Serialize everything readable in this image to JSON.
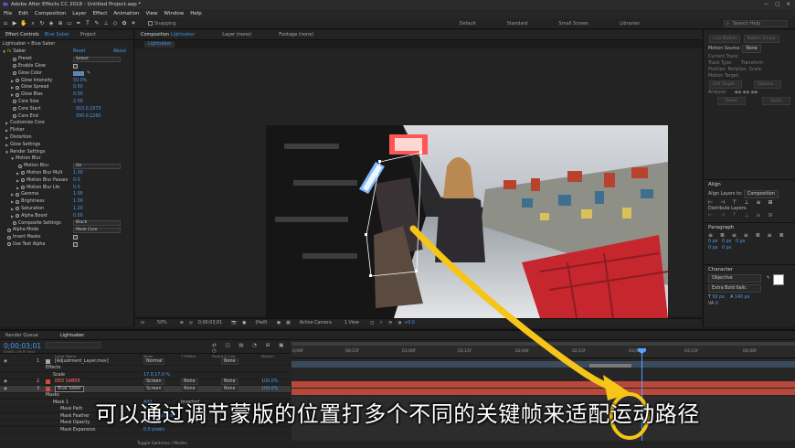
{
  "window": {
    "title": "Adobe After Effects CC 2018 - Untitled Project.aep *",
    "controls": [
      "—",
      "□",
      "✕"
    ]
  },
  "menu": [
    "File",
    "Edit",
    "Composition",
    "Layer",
    "Effect",
    "Animation",
    "View",
    "Window",
    "Help"
  ],
  "toolbar": {
    "snapping_label": "Snapping",
    "workspaces": [
      "Default",
      "Standard",
      "Small Screen",
      "Libraries"
    ],
    "search_placeholder": "Search Help"
  },
  "effect_panel": {
    "tabs": [
      "Effect Controls",
      "Blue Saber",
      "Project"
    ],
    "layer_path": "Lightsaber • Blue Saber",
    "effect_name": "Saber",
    "reset_label": "Reset",
    "about_label": "About",
    "rows": [
      {
        "label": "Preset",
        "value": "Select",
        "type": "select",
        "indent": 1
      },
      {
        "label": "Enable Glow",
        "value": "",
        "type": "check",
        "indent": 1
      },
      {
        "label": "Glow Color",
        "value": "",
        "type": "color",
        "indent": 1
      },
      {
        "label": "Glow Intensity",
        "value": "50.0%",
        "type": "num",
        "indent": 1
      },
      {
        "label": "Glow Spread",
        "value": "0.50",
        "type": "num",
        "indent": 1
      },
      {
        "label": "Glow Bias",
        "value": "0.50",
        "type": "num",
        "indent": 1
      },
      {
        "label": "Core Size",
        "value": "2.00",
        "type": "num",
        "indent": 1
      },
      {
        "label": "Core Start",
        "value": "910.0,1973",
        "type": "num",
        "indent": 1
      },
      {
        "label": "Core End",
        "value": "590.0,1260",
        "type": "num",
        "indent": 1
      },
      {
        "label": "Customize Core",
        "value": "",
        "type": "group",
        "indent": 0
      },
      {
        "label": "Flicker",
        "value": "",
        "type": "group",
        "indent": 0
      },
      {
        "label": "Distortion",
        "value": "",
        "type": "group",
        "indent": 0
      },
      {
        "label": "Glow Settings",
        "value": "",
        "type": "group",
        "indent": 0
      },
      {
        "label": "Render Settings",
        "value": "",
        "type": "group",
        "indent": 0
      },
      {
        "label": "Motion Blur",
        "value": "",
        "type": "group",
        "indent": 1
      },
      {
        "label": "Motion Blur",
        "value": "On",
        "type": "select",
        "indent": 2
      },
      {
        "label": "Motion Blur Mult",
        "value": "1.00",
        "type": "num",
        "indent": 2
      },
      {
        "label": "Motion Blur Passes",
        "value": "0.0",
        "type": "num",
        "indent": 2
      },
      {
        "label": "Motion Blur Lfe",
        "value": "0.0",
        "type": "num",
        "indent": 2
      },
      {
        "label": "Gamma",
        "value": "1.00",
        "type": "num",
        "indent": 1
      },
      {
        "label": "Brightness",
        "value": "1.00",
        "type": "num",
        "indent": 1
      },
      {
        "label": "Saturation",
        "value": "1.20",
        "type": "num",
        "indent": 1
      },
      {
        "label": "Alpha Boost",
        "value": "0.00",
        "type": "num",
        "indent": 1
      },
      {
        "label": "Composite Settings",
        "value": "Black",
        "type": "select",
        "indent": 1
      },
      {
        "label": "Alpha Mode",
        "value": "Mask Core",
        "type": "select",
        "indent": 0
      },
      {
        "label": "Invert Masks",
        "value": "",
        "type": "check",
        "indent": 0
      },
      {
        "label": "Use Text Alpha",
        "value": "",
        "type": "check",
        "indent": 0
      }
    ]
  },
  "comp": {
    "tabs": [
      "Composition",
      "Lightsaber",
      "Layer (none)",
      "Footage (none)"
    ],
    "subtab": "Lightsaber",
    "footer": [
      "50%",
      "0;00;03;01",
      "(Half)",
      "Active Camera",
      "1 View",
      "+0.0"
    ]
  },
  "right_panel": {
    "top_buttons": [
      "Line Motion",
      "Motion Smear"
    ],
    "motion_source_label": "Motion Source:",
    "motion_source_value": "None",
    "rows": [
      "Current Track:",
      "Track Type:",
      "Position",
      "Rotation",
      "Scale",
      "Motion Target:",
      "Edit Target...",
      "Options...",
      "Analyze:",
      "Reset",
      "Apply"
    ],
    "track_type_value": "Transform",
    "align_title": "Align",
    "align_to_label": "Align Layers to:",
    "align_to_value": "Composition",
    "distribute_label": "Distribute Layers:",
    "paragraph_title": "Paragraph",
    "para_values": [
      "0 px",
      "0 px",
      "0 px",
      "0 px",
      "0 px"
    ],
    "character_title": "Character",
    "font_name": "Objective",
    "font_style": "Extra Bold Italic",
    "font_size": "92 px",
    "leading": "140 px",
    "tracking": "0"
  },
  "timeline": {
    "tabs": [
      "Render Queue",
      "Lightsaber"
    ],
    "timecode": "0;00;03;01",
    "fps_text": "00091 (29.97 fps)",
    "column_headers": [
      "Layer Name",
      "Mode",
      "T TrkMat",
      "Parent & Link",
      "Stretch"
    ],
    "ruler_ticks": [
      "0;00f",
      "00;15f",
      "01;00f",
      "01;15f",
      "02;00f",
      "02;15f",
      "03;00f",
      "03;15f",
      "04;00f"
    ],
    "layers": [
      {
        "num": "1",
        "name": "[Adjustment_Layer.mov]",
        "mode": "Normal",
        "trkmat": "",
        "parent": "None",
        "stretch": "",
        "color": "#9aa6b8"
      },
      {
        "num": "",
        "name": "Effects",
        "mode": "",
        "trkmat": "",
        "parent": "",
        "stretch": "",
        "color": ""
      },
      {
        "num": "",
        "name": "Scale",
        "mode": "",
        "trkmat": "",
        "parent": "",
        "stretch": "",
        "value": "17.0,17.0 %",
        "color": ""
      },
      {
        "num": "2",
        "name": "RED SABER",
        "mode": "Screen",
        "trkmat": "None",
        "parent": "None",
        "stretch": "100.0%",
        "color": "#d24a3f"
      },
      {
        "num": "3",
        "name": "Blue Saber",
        "mode": "Screen",
        "trkmat": "None",
        "parent": "None",
        "stretch": "100.0%",
        "color": "#d24a3f"
      },
      {
        "num": "",
        "name": "Masks",
        "mode": "",
        "trkmat": "",
        "parent": "",
        "stretch": "",
        "color": ""
      },
      {
        "num": "",
        "name": "Mask 1",
        "mode": "Add",
        "trkmat": "Inverted",
        "parent": "",
        "stretch": "",
        "color": ""
      },
      {
        "num": "",
        "name": "Mask Path",
        "mode": "Shape...",
        "trkmat": "",
        "parent": "",
        "stretch": "",
        "color": ""
      },
      {
        "num": "",
        "name": "Mask Feather",
        "mode": "0.0,0.0 pixels",
        "trkmat": "",
        "parent": "",
        "stretch": "",
        "color": ""
      },
      {
        "num": "",
        "name": "Mask Opacity",
        "mode": "100 %",
        "trkmat": "",
        "parent": "",
        "stretch": "",
        "color": ""
      },
      {
        "num": "",
        "name": "Mask Expansion",
        "mode": "0.0 pixels",
        "trkmat": "",
        "parent": "",
        "stretch": "",
        "color": ""
      }
    ],
    "toggle_label": "Toggle Switches / Modes"
  },
  "subtitle": "可以通过调节蒙版的位置打多个不同的关键帧来适配运动路径",
  "colors": {
    "accent": "#3a8ee0",
    "saber_red": "#d24a3f",
    "highlight": "#f5c518"
  }
}
